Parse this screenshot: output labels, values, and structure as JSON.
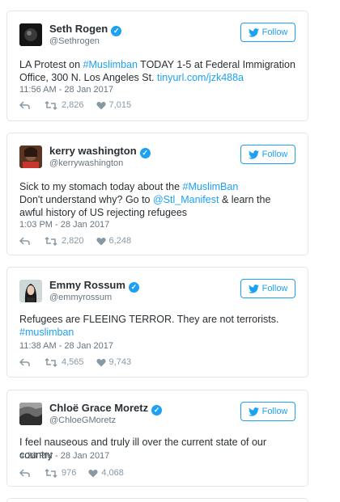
{
  "follow_label": "Follow",
  "colors": {
    "link": "#1da1f2",
    "muted": "#66757f",
    "border": "#e1e8ed"
  },
  "tweets": [
    {
      "name": "Seth Rogen",
      "handle": "@Sethrogen",
      "text_parts": [
        "LA Protest on ",
        "#Muslimban",
        " TODAY 1-5 at Federal Immigration Office, 300 N. Los Angeles St. ",
        "tinyurl.com/jzk488a"
      ],
      "time": "11:56 AM - 28 Jan 2017",
      "retweets": "2,826",
      "likes": "7,015"
    },
    {
      "name": "kerry washington",
      "handle": "@kerrywashington",
      "text_parts": [
        "Sick to my stomach today about the ",
        "#MuslimBan",
        "Don't understand why? Go to ",
        "@Stl_Manifest",
        " & learn the awful history of US rejecting refugees"
      ],
      "time": "1:03 PM - 28 Jan 2017",
      "retweets": "2,820",
      "likes": "6,248"
    },
    {
      "name": "Emmy Rossum",
      "handle": "@emmyrossum",
      "text_parts": [
        "Refugees are FLEEING TERROR. They are not terrorists.",
        "#muslimban"
      ],
      "time": "11:38 AM - 28 Jan 2017",
      "retweets": "4,565",
      "likes": "9,743"
    },
    {
      "name": "Chloë Grace Moretz",
      "handle": "@ChloeGMoretz",
      "text_parts": [
        "I feel nauseous and truly ill over the current state of our country"
      ],
      "time": "4:38 PM - 28 Jan 2017",
      "retweets": "976",
      "likes": "4,068"
    }
  ]
}
